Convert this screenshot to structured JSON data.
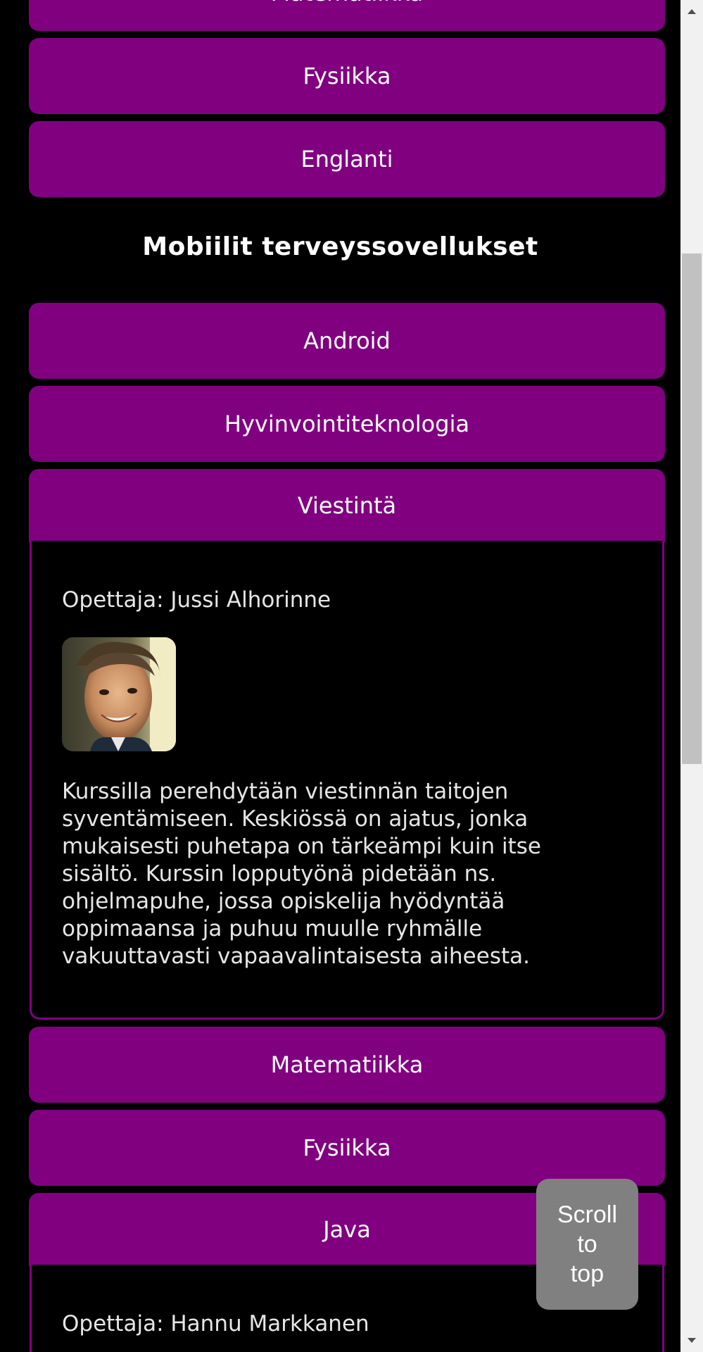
{
  "accordion_top": [
    {
      "label": "Matematiikka"
    },
    {
      "label": "Fysiikka"
    },
    {
      "label": "Englanti"
    }
  ],
  "section": {
    "title": "Mobiilit terveyssovellukset"
  },
  "accordion_main": [
    {
      "label": "Android"
    },
    {
      "label": "Hyvinvointiteknologia"
    },
    {
      "label": "Viestintä"
    },
    {
      "label": "Matematiikka"
    },
    {
      "label": "Fysiikka"
    },
    {
      "label": "Java"
    }
  ],
  "viestinta_panel": {
    "teacher": "Opettaja: Jussi Alhorinne",
    "description": "Kurssilla perehdytään viestinnän taitojen syventämiseen. Keskiössä on ajatus, jonka mukaisesti puhetapa on tärkeämpi kuin itse sisältö. Kurssin lopputyönä pidetään ns. ohjelmapuhe, jossa opiskelija hyödyntää oppimaansa ja puhuu muulle ryhmälle vakuuttavasti vapaavalintaisesta aiheesta."
  },
  "java_panel": {
    "teacher": "Opettaja: Hannu Markkanen"
  },
  "scroll_to_top": {
    "line1": "Scroll",
    "line2": "to",
    "line3": "top"
  },
  "colors": {
    "accent": "#800080",
    "background": "#000000",
    "scroll_button": "#808080"
  }
}
